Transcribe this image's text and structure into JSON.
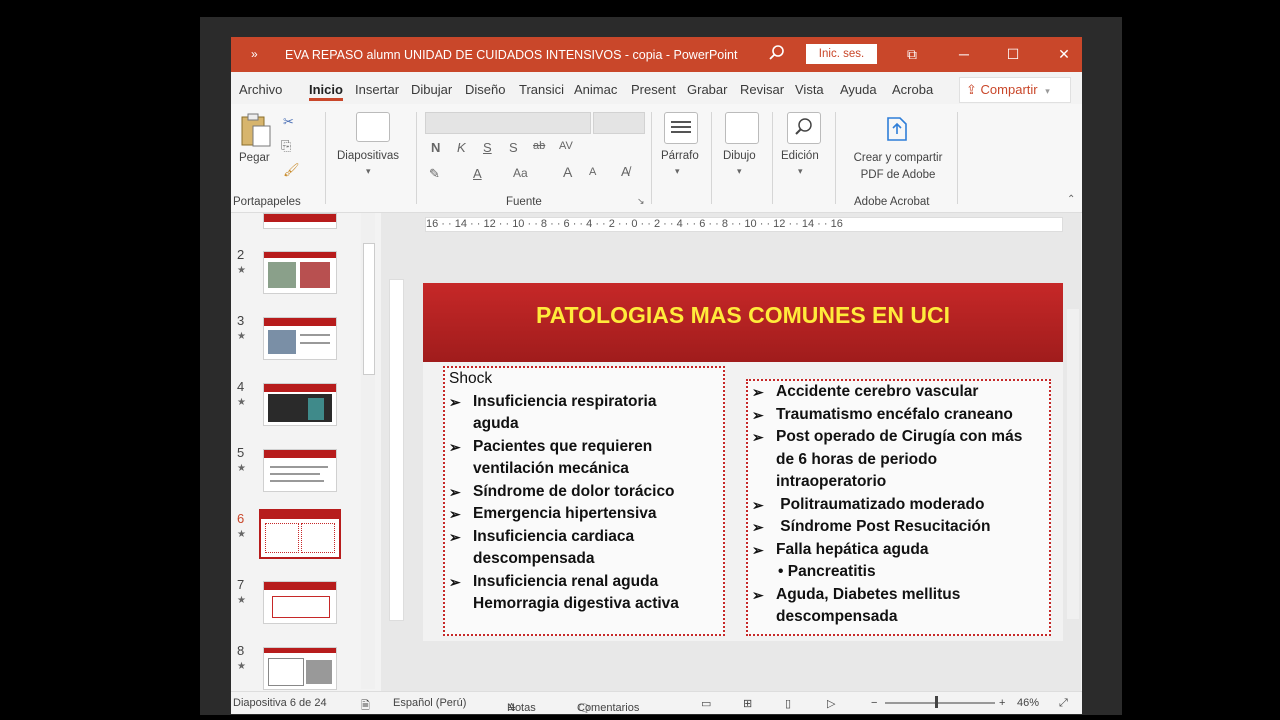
{
  "window": {
    "title": "EVA REPASO alumn UNIDAD DE CUIDADOS INTENSIVOS - copia  -  PowerPoint",
    "signin": "Inic. ses.",
    "quick_access": "»"
  },
  "tabs": [
    "Archivo",
    "Inicio",
    "Insertar",
    "Dibujar",
    "Diseño",
    "Transici",
    "Animac",
    "Present",
    "Grabar",
    "Revisar",
    "Vista",
    "Ayuda",
    "Acroba"
  ],
  "share_label": "Compartir",
  "ribbon": {
    "paste": "Pegar",
    "portapapeles": "Portapapeles",
    "diapositivas": "Diapositivas",
    "fuente": "Fuente",
    "parrafo": "Párrafo",
    "dibujo": "Dibujo",
    "edicion": "Edición",
    "acrobat_button": "Crear y compartir PDF de Adobe",
    "acrobat_group": "Adobe Acrobat",
    "font_glyphs": {
      "bold": "N",
      "italic": "K",
      "underline": "S",
      "strike": "S",
      "grow": "A",
      "shrink": "A",
      "case": "Aa"
    }
  },
  "ruler": "16 · · 14 · · 12 · · 10 · · 8 · · 6 · · 4 · · 2 · · 0 · · 2 · · 4 · · 6 · · 8 · · 10 · · 12 · · 14 · · 16",
  "slides_panel": {
    "numbers": [
      "2",
      "3",
      "4",
      "5",
      "6",
      "7",
      "8"
    ],
    "selected": "6"
  },
  "slide": {
    "title": "PATOLOGIAS MAS COMUNES EN UCI",
    "left_box": {
      "heading": "Shock",
      "items": [
        [
          "Insuficiencia respiratoria",
          "aguda"
        ],
        [
          "Pacientes que requieren",
          "ventilación mecánica"
        ],
        [
          "Síndrome de dolor torácico"
        ],
        [
          "Emergencia hipertensiva"
        ],
        [
          "Insuficiencia cardiaca",
          "descompensada"
        ],
        [
          "Insuficiencia renal aguda",
          "Hemorragia digestiva activa"
        ]
      ]
    },
    "right_box": {
      "items": [
        [
          "Accidente cerebro vascular"
        ],
        [
          "Traumatismo encéfalo craneano"
        ],
        [
          "Post operado de Cirugía con más",
          "de 6 horas de periodo",
          "intraoperatorio"
        ],
        [
          " Politraumatizado moderado"
        ],
        [
          " Síndrome Post Resucitación"
        ],
        [
          "Falla hepática aguda"
        ]
      ],
      "bullet_item": "Pancreatitis",
      "last_item": [
        "Aguda, Diabetes mellitus",
        "descompensada"
      ]
    }
  },
  "status": {
    "slide_info": "Diapositiva 6 de 24",
    "language": "Español (Perú)",
    "notes": "Notas",
    "comments": "Comentarios",
    "zoom": "46%"
  }
}
